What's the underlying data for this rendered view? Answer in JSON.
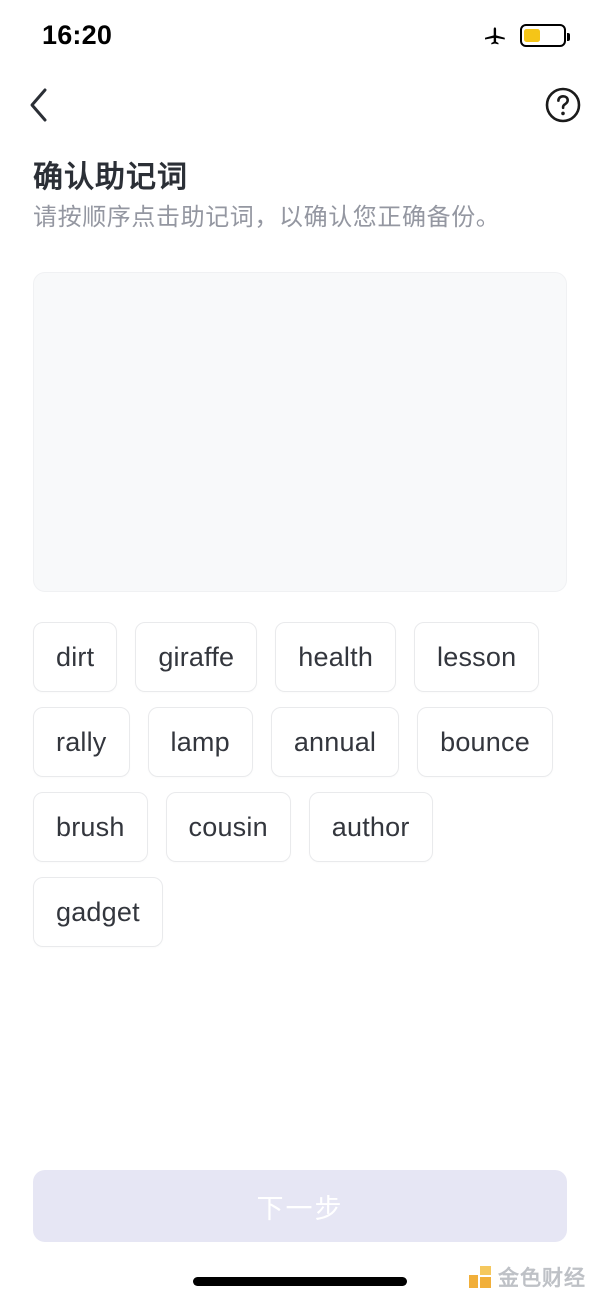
{
  "status_bar": {
    "time": "16:20",
    "airplane_icon": "airplane-mode-icon",
    "battery_icon": "battery-icon",
    "battery_fill_color": "#f5c518",
    "battery_level_percent": 40
  },
  "nav": {
    "back_icon": "chevron-left-icon",
    "help_icon": "help-circle-icon"
  },
  "header": {
    "title": "确认助记词",
    "subtitle": "请按顺序点击助记词，以确认您正确备份。"
  },
  "selected_area": {
    "selected_words": []
  },
  "word_bank": {
    "words": [
      "dirt",
      "giraffe",
      "health",
      "lesson",
      "rally",
      "lamp",
      "annual",
      "bounce",
      "brush",
      "cousin",
      "author",
      "gadget"
    ]
  },
  "footer": {
    "next_label": "下一步",
    "next_disabled": true,
    "next_bg_color": "#e6e6f4",
    "next_text_color": "#ffffff"
  },
  "watermark": {
    "text": "金色财经",
    "logo_color": "#f0a92a"
  }
}
